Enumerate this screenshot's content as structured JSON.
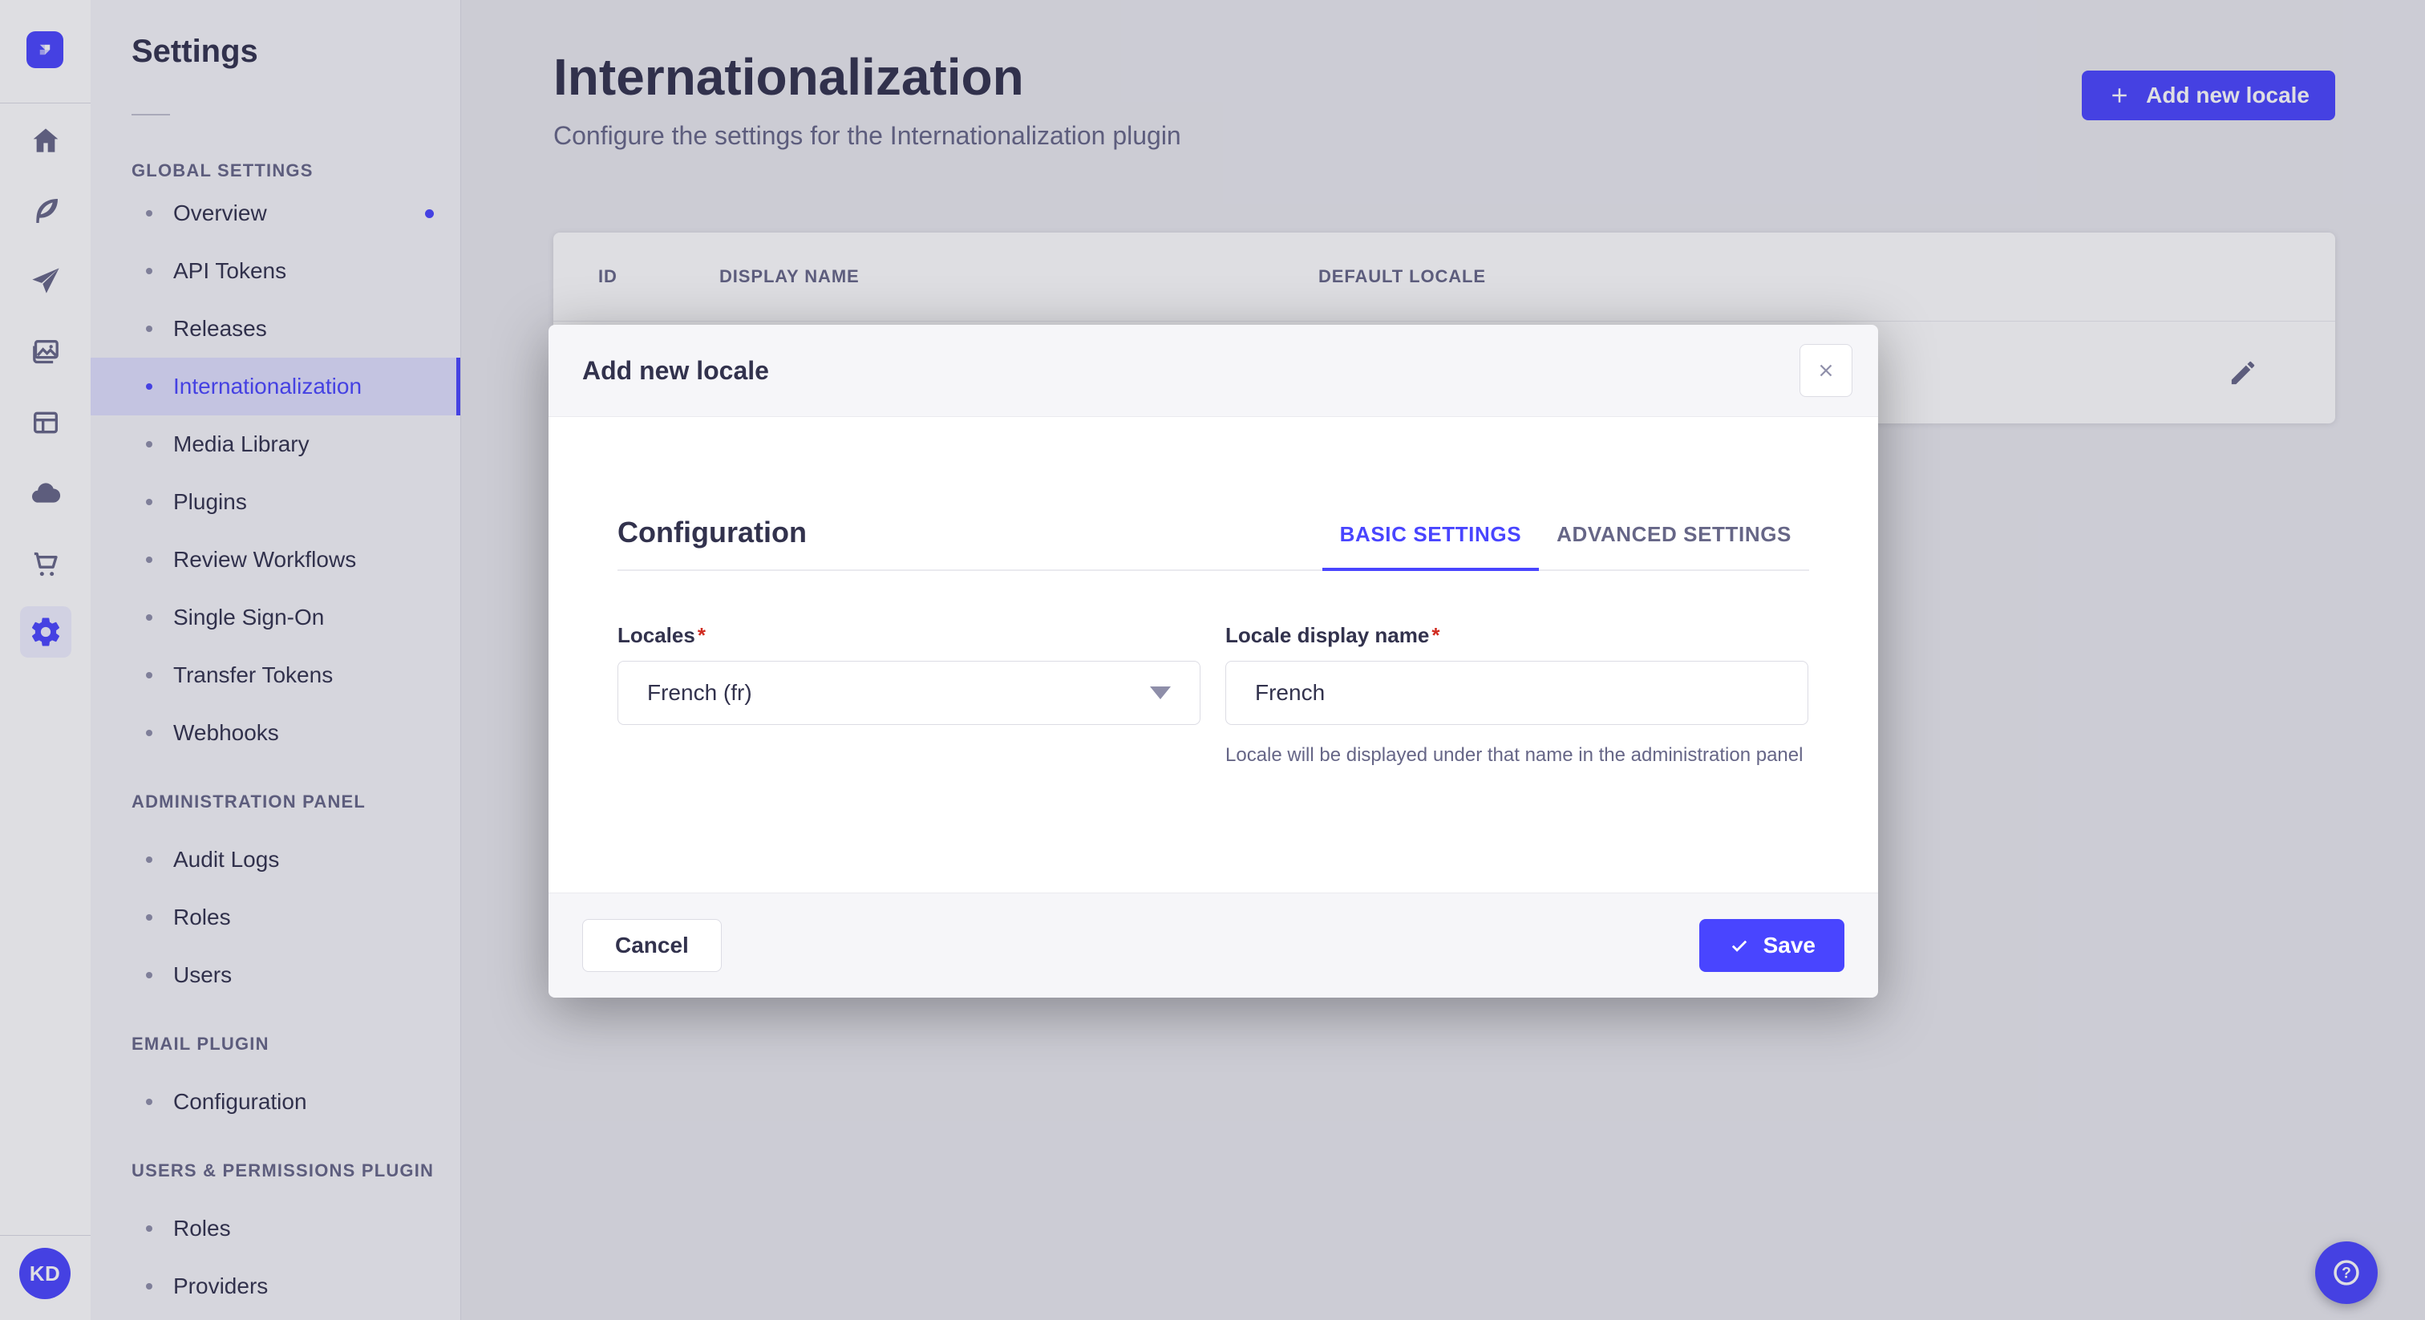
{
  "colors": {
    "primary": "#4945ff",
    "primary_light": "#f0f0ff",
    "heading": "#32324d",
    "muted": "#666687",
    "border": "#dcdce4",
    "danger": "#d02b20"
  },
  "rail": {
    "logo_icon": "strapi-logo",
    "nav_icons": [
      "home",
      "content-builder",
      "deploy",
      "media-library",
      "apps",
      "cloud",
      "marketplace",
      "settings"
    ],
    "active_icon": "settings",
    "user_initials": "KD"
  },
  "subnav": {
    "title": "Settings",
    "sections": [
      {
        "label": "GLOBAL SETTINGS",
        "items": [
          {
            "label": "Overview",
            "notification": true
          },
          {
            "label": "API Tokens"
          },
          {
            "label": "Releases"
          },
          {
            "label": "Internationalization",
            "active": true
          },
          {
            "label": "Media Library"
          },
          {
            "label": "Plugins"
          },
          {
            "label": "Review Workflows"
          },
          {
            "label": "Single Sign-On"
          },
          {
            "label": "Transfer Tokens"
          },
          {
            "label": "Webhooks"
          }
        ]
      },
      {
        "label": "ADMINISTRATION PANEL",
        "items": [
          {
            "label": "Audit Logs"
          },
          {
            "label": "Roles"
          },
          {
            "label": "Users"
          }
        ]
      },
      {
        "label": "EMAIL PLUGIN",
        "items": [
          {
            "label": "Configuration"
          }
        ]
      },
      {
        "label": "USERS & PERMISSIONS PLUGIN",
        "items": [
          {
            "label": "Roles"
          },
          {
            "label": "Providers"
          }
        ]
      }
    ]
  },
  "main": {
    "title": "Internationalization",
    "subtitle": "Configure the settings for the Internationalization plugin",
    "add_button_label": "Add new locale",
    "table": {
      "columns": [
        "ID",
        "DISPLAY NAME",
        "DEFAULT LOCALE"
      ]
    }
  },
  "modal": {
    "title": "Add new locale",
    "section_title": "Configuration",
    "tabs": [
      {
        "label": "BASIC SETTINGS",
        "active": true
      },
      {
        "label": "ADVANCED SETTINGS",
        "active": false
      }
    ],
    "locales_field": {
      "label": "Locales",
      "required_mark": "*",
      "value": "French (fr)"
    },
    "display_name_field": {
      "label": "Locale display name",
      "required_mark": "*",
      "value": "French",
      "helper": "Locale will be displayed under that name in the administration panel"
    },
    "cancel_label": "Cancel",
    "save_label": "Save"
  },
  "user": {
    "initials": "KD"
  }
}
